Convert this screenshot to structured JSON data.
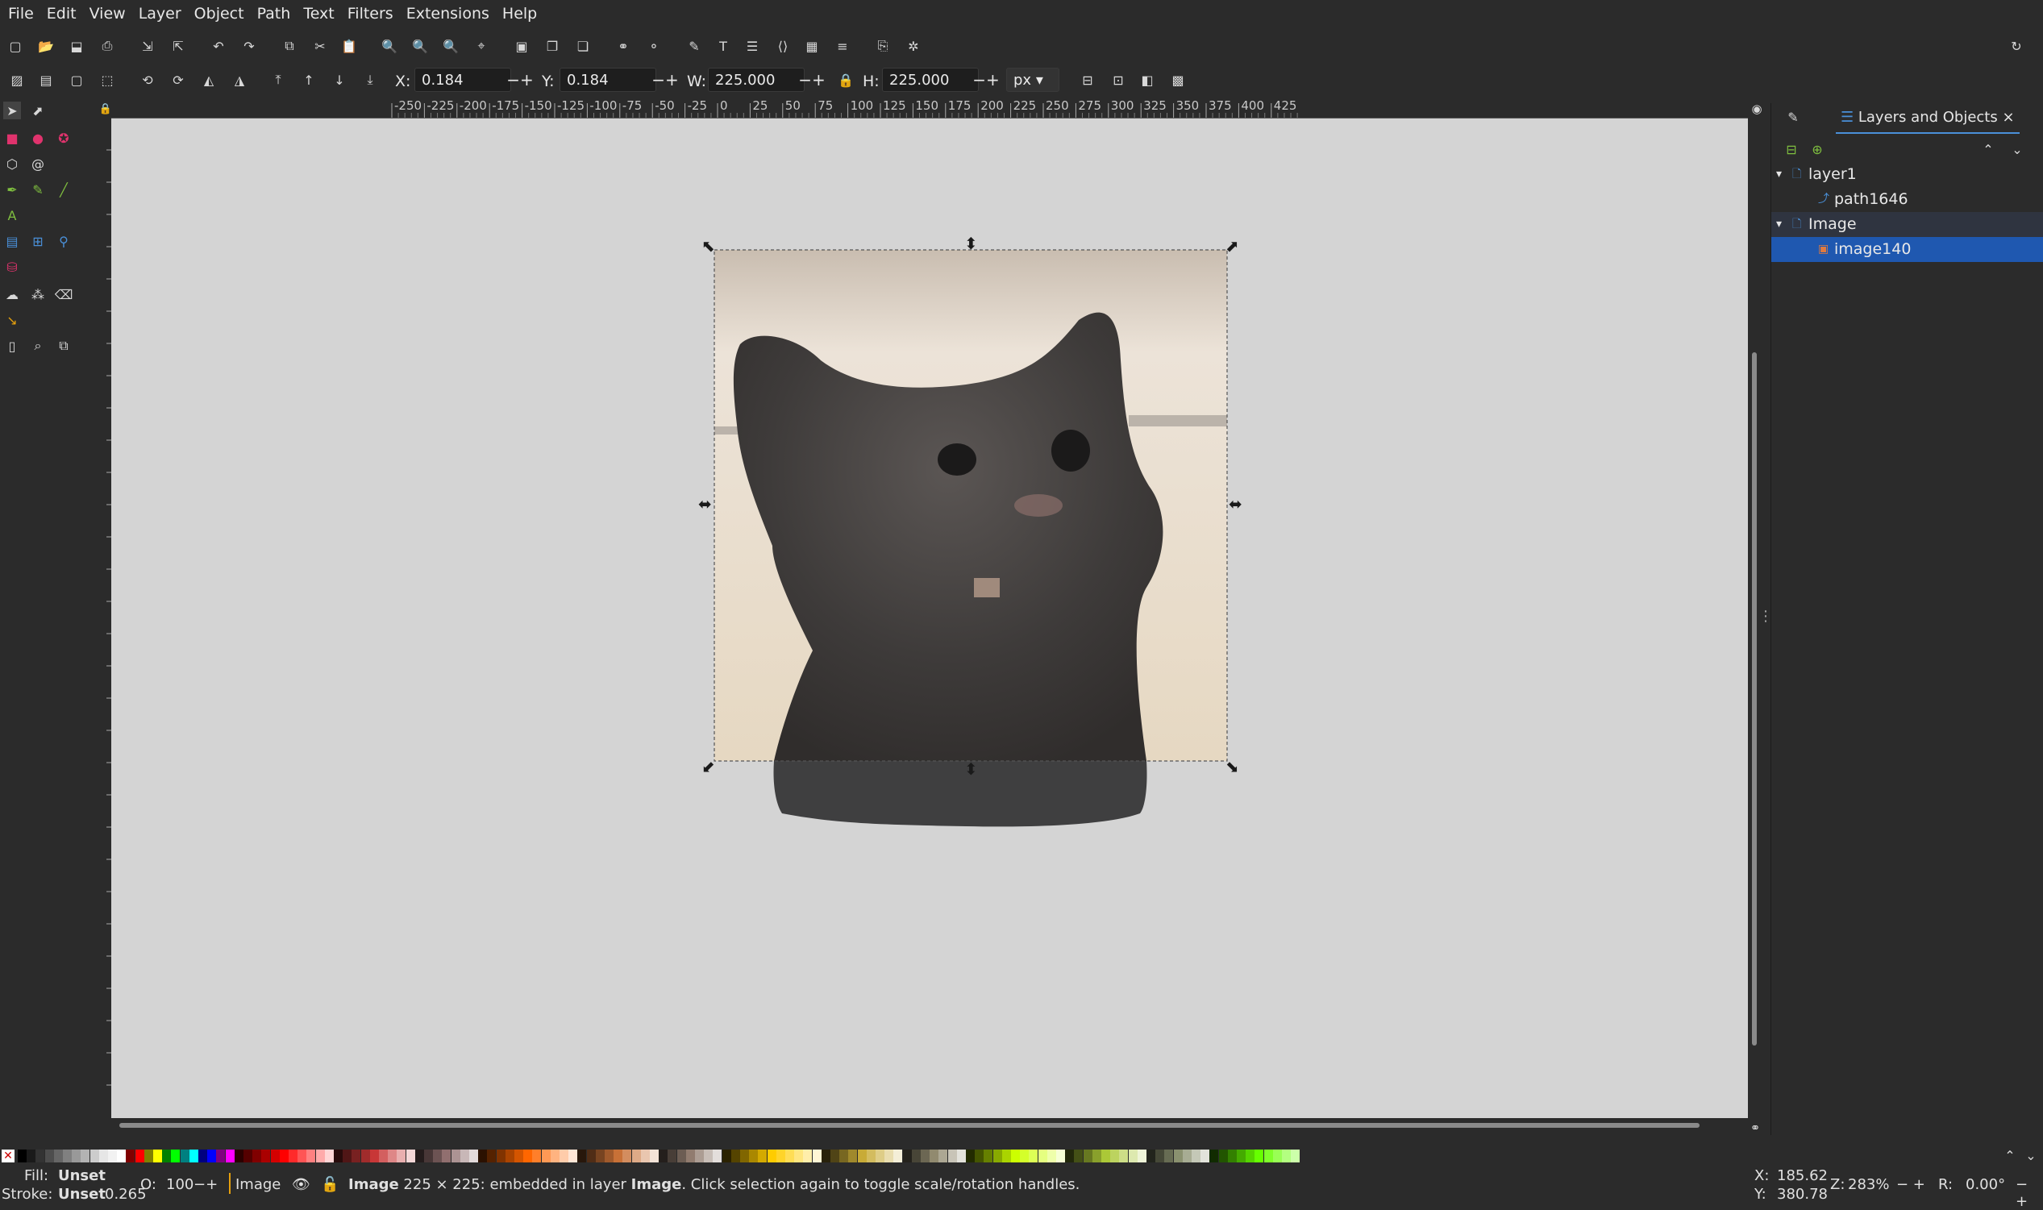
{
  "menu": [
    "File",
    "Edit",
    "View",
    "Layer",
    "Object",
    "Path",
    "Text",
    "Filters",
    "Extensions",
    "Help"
  ],
  "toolbar": {
    "x_label": "X:",
    "x_value": "0.184",
    "y_label": "Y:",
    "y_value": "0.184",
    "w_label": "W:",
    "w_value": "225.000",
    "h_label": "H:",
    "h_value": "225.000",
    "unit": "px",
    "minus": "−",
    "plus": "+"
  },
  "ruler": {
    "h_ticks": [
      "-250",
      "-225",
      "-200",
      "-175",
      "-150",
      "-125",
      "-100",
      "-75",
      "-50",
      "-25",
      "0",
      "25",
      "50",
      "75",
      "100",
      "125",
      "150",
      "175",
      "200",
      "225",
      "250",
      "275",
      "300",
      "325",
      "350",
      "375",
      "400",
      "425"
    ]
  },
  "panel": {
    "tab_label": "Layers and Objects",
    "tree": [
      {
        "label": "layer1",
        "kind": "layer",
        "expanded": true,
        "selected": false
      },
      {
        "label": "path1646",
        "kind": "path",
        "expanded": false,
        "selected": false
      },
      {
        "label": "Image",
        "kind": "layer",
        "expanded": true,
        "selected": false
      },
      {
        "label": "image140",
        "kind": "image",
        "expanded": false,
        "selected": true
      }
    ]
  },
  "status": {
    "fill_label": "Fill:",
    "fill_value": "Unset",
    "stroke_label": "Stroke:",
    "stroke_value": "Unset",
    "stroke_width": "0.265",
    "opacity_label": "O:",
    "opacity_value": "100",
    "layer_name": "Image",
    "message_bold": "Image",
    "message_1": " 225 × 225: embedded in layer ",
    "message_layer": "Image",
    "message_2": ". Click selection again to toggle scale/rotation handles.",
    "cursor_x_label": "X:",
    "cursor_x": "185.62",
    "cursor_y_label": "Y:",
    "cursor_y": "380.78",
    "zoom_label": "Z:",
    "zoom": "283%",
    "rotation_label": "R:",
    "rotation": "0.00°"
  },
  "colors": {
    "accent": "#1f58b0",
    "canvas": "#d4d4d4",
    "ui_bg": "#2b2b2b"
  }
}
